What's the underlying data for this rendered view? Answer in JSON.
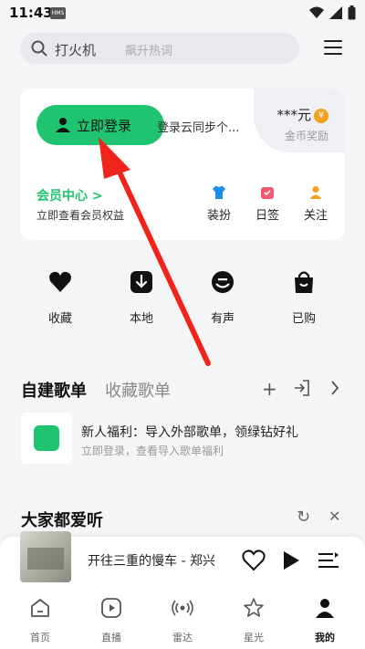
{
  "status_bar": {
    "time": "11:43",
    "badge": "HMS"
  },
  "search": {
    "main": "打火机",
    "hint": "飙升热词"
  },
  "profile": {
    "login_label": "立即登录",
    "sync_text": "登录云同步个...",
    "coins_amount": "***元",
    "coins_symbol": "¥",
    "coins_label": "金币奖励",
    "member_title": "会员中心 >",
    "member_sub": "立即查看会员权益"
  },
  "quick_actions": [
    {
      "label": "装扮",
      "icon": "shirt-icon",
      "color": "#1e8bf0"
    },
    {
      "label": "日签",
      "icon": "calendar-icon",
      "color": "#f25a6e"
    },
    {
      "label": "关注",
      "icon": "person-icon",
      "color": "#f0a21f"
    }
  ],
  "functions": [
    {
      "label": "收藏",
      "icon": "heart-icon"
    },
    {
      "label": "本地",
      "icon": "download-icon"
    },
    {
      "label": "有声",
      "icon": "audio-icon"
    },
    {
      "label": "已购",
      "icon": "bag-icon"
    }
  ],
  "playlists": {
    "tab_active": "自建歌单",
    "tab_inactive": "收藏歌单",
    "promo_title": "新人福利：导入外部歌单，领绿钻好礼",
    "promo_sub": "立即登录，查看导入歌单福利"
  },
  "recommend": {
    "title": "大家都爱听"
  },
  "player": {
    "song": "开往三重的慢车 - 郑兴"
  },
  "nav": [
    {
      "label": "首页",
      "icon": "home-icon"
    },
    {
      "label": "直播",
      "icon": "live-icon"
    },
    {
      "label": "雷达",
      "icon": "radar-icon"
    },
    {
      "label": "星光",
      "icon": "star-icon"
    },
    {
      "label": "我的",
      "icon": "profile-icon",
      "active": true
    }
  ],
  "colors": {
    "accent": "#1ec46f",
    "annotation": "#f0241b"
  }
}
